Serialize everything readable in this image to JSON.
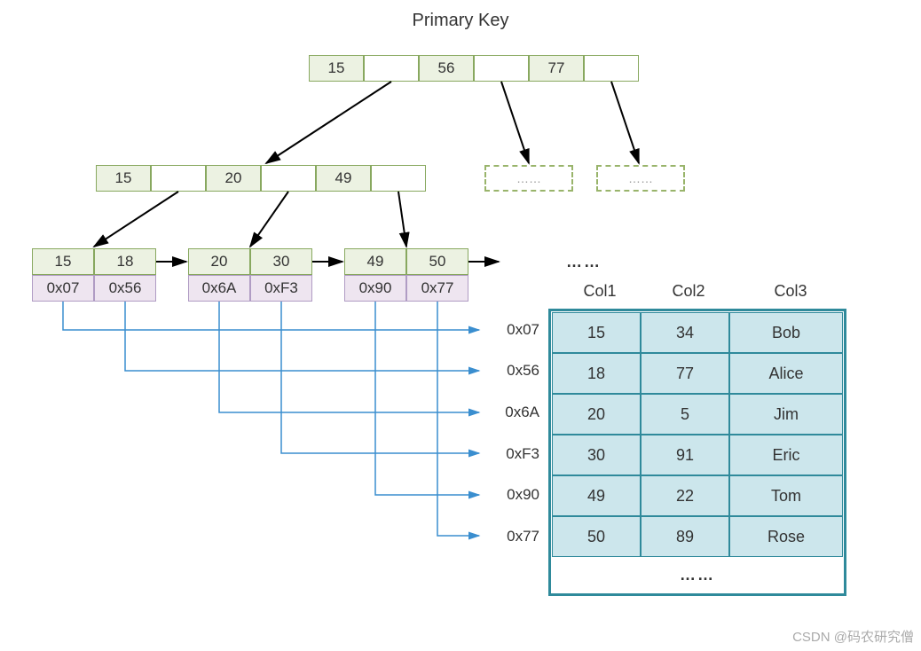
{
  "title": "Primary Key",
  "root": {
    "keys": [
      "15",
      "56",
      "77"
    ]
  },
  "internal": {
    "keys": [
      "15",
      "20",
      "49"
    ]
  },
  "leaves": [
    {
      "keys": [
        "15",
        "18"
      ],
      "addrs": [
        "0x07",
        "0x56"
      ]
    },
    {
      "keys": [
        "20",
        "30"
      ],
      "addrs": [
        "0x6A",
        "0xF3"
      ]
    },
    {
      "keys": [
        "49",
        "50"
      ],
      "addrs": [
        "0x90",
        "0x77"
      ]
    }
  ],
  "leaf_ellipsis": "……",
  "row_addrs": [
    "0x07",
    "0x56",
    "0x6A",
    "0xF3",
    "0x90",
    "0x77"
  ],
  "table": {
    "cols": [
      "Col1",
      "Col2",
      "Col3"
    ],
    "rows": [
      [
        "15",
        "34",
        "Bob"
      ],
      [
        "18",
        "77",
        "Alice"
      ],
      [
        "20",
        "5",
        "Jim"
      ],
      [
        "30",
        "91",
        "Eric"
      ],
      [
        "49",
        "22",
        "Tom"
      ],
      [
        "50",
        "89",
        "Rose"
      ]
    ],
    "ellipsis": "……"
  },
  "watermark": "CSDN @码农研究僧",
  "placeholder": "……"
}
